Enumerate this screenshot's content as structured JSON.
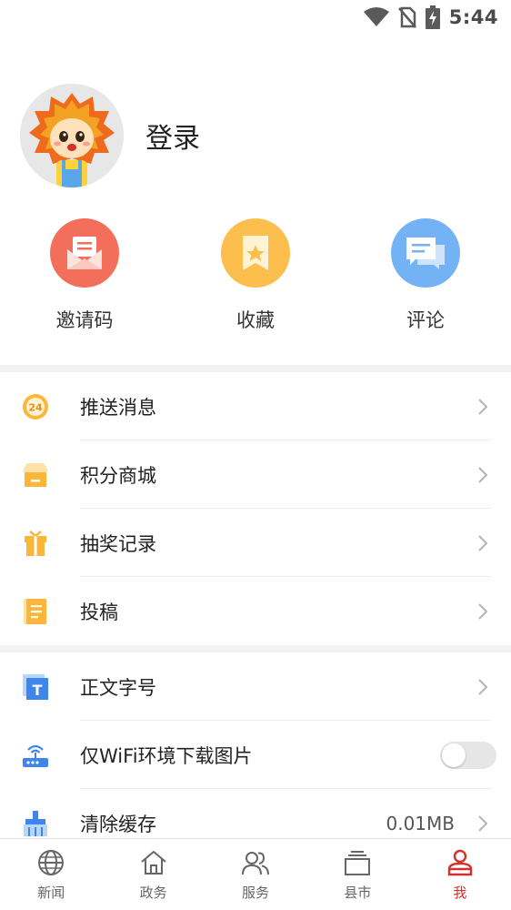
{
  "status_bar": {
    "time": "5:44",
    "icons": [
      "wifi-icon",
      "no-sim-icon",
      "battery-charging-icon"
    ]
  },
  "profile": {
    "login_label": "登录",
    "avatar_icon": "lion-mascot-avatar"
  },
  "quick_actions": [
    {
      "label": "邀请码",
      "icon": "invite-envelope-icon",
      "color": "#f36f5b"
    },
    {
      "label": "收藏",
      "icon": "bookmark-star-icon",
      "color": "#fcbf4e"
    },
    {
      "label": "评论",
      "icon": "comment-bubbles-icon",
      "color": "#72b2f5"
    }
  ],
  "menu_group_1": [
    {
      "label": "推送消息",
      "icon": "push-24-icon"
    },
    {
      "label": "积分商城",
      "icon": "shop-icon"
    },
    {
      "label": "抽奖记录",
      "icon": "gift-icon"
    },
    {
      "label": "投稿",
      "icon": "notebook-icon"
    }
  ],
  "menu_group_2": [
    {
      "label": "正文字号",
      "icon": "font-size-icon"
    },
    {
      "label": "仅WiFi环境下载图片",
      "icon": "router-icon",
      "toggle": false
    },
    {
      "label": "清除缓存",
      "icon": "broom-icon",
      "value": "0.01MB"
    }
  ],
  "bottom_nav": [
    {
      "label": "新闻",
      "icon": "globe-icon",
      "active": false
    },
    {
      "label": "政务",
      "icon": "home-icon",
      "active": false
    },
    {
      "label": "服务",
      "icon": "users-icon",
      "active": false
    },
    {
      "label": "县市",
      "icon": "layers-icon",
      "active": false
    },
    {
      "label": "我",
      "icon": "profile-icon",
      "active": true
    }
  ],
  "colors": {
    "accent": "#d5312c",
    "divider": "#f2f2f2"
  }
}
